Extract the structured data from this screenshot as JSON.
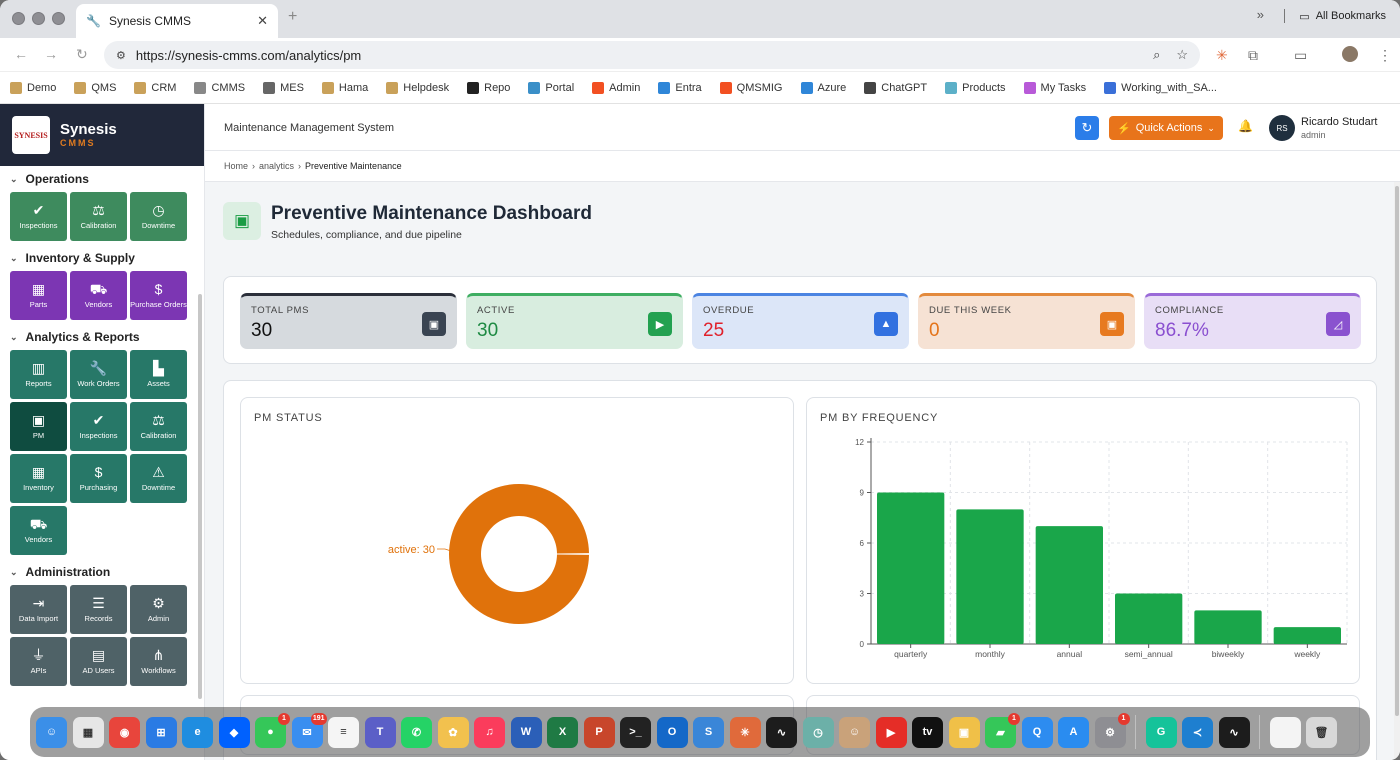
{
  "browser": {
    "tab_title": "Synesis CMMS",
    "url": "https://synesis-cmms.com/analytics/pm",
    "bookmarks": [
      {
        "label": "Demo",
        "color": "#c9a15a"
      },
      {
        "label": "QMS",
        "color": "#c9a15a"
      },
      {
        "label": "CRM",
        "color": "#c9a15a"
      },
      {
        "label": "CMMS",
        "color": "#888888"
      },
      {
        "label": "MES",
        "color": "#666666"
      },
      {
        "label": "Hama",
        "color": "#c9a15a"
      },
      {
        "label": "Helpdesk",
        "color": "#c9a15a"
      },
      {
        "label": "Repo",
        "color": "#222222"
      },
      {
        "label": "Portal",
        "color": "#3a8fc8"
      },
      {
        "label": "Admin",
        "color": "#f25022"
      },
      {
        "label": "Entra",
        "color": "#2f86d8"
      },
      {
        "label": "QMSMIG",
        "color": "#f25022"
      },
      {
        "label": "Azure",
        "color": "#2f86d8"
      },
      {
        "label": "ChatGPT",
        "color": "#444444"
      },
      {
        "label": "Products",
        "color": "#5cb0c8"
      },
      {
        "label": "My Tasks",
        "color": "#b85ad8"
      },
      {
        "label": "Working_with_SA...",
        "color": "#3a6fd8"
      }
    ],
    "all_bookmarks": "All Bookmarks"
  },
  "brand": {
    "name": "Synesis",
    "sub": "CMMS",
    "logo": "SYNESIS"
  },
  "sidebar": {
    "operations": {
      "title": "Operations",
      "items": [
        {
          "label": "Inspections",
          "icon": "✔"
        },
        {
          "label": "Calibration",
          "icon": "⚖"
        },
        {
          "label": "Downtime",
          "icon": "◷"
        }
      ]
    },
    "inventory": {
      "title": "Inventory & Supply",
      "items": [
        {
          "label": "Parts",
          "icon": "▦"
        },
        {
          "label": "Vendors",
          "icon": "⛟"
        },
        {
          "label": "Purchase Orders",
          "icon": "$"
        }
      ]
    },
    "analytics": {
      "title": "Analytics & Reports",
      "items": [
        {
          "label": "Reports",
          "icon": "▥"
        },
        {
          "label": "Work Orders",
          "icon": "🔧"
        },
        {
          "label": "Assets",
          "icon": "▙"
        },
        {
          "label": "PM",
          "icon": "▣"
        },
        {
          "label": "Inspections",
          "icon": "✔"
        },
        {
          "label": "Calibration",
          "icon": "⚖"
        },
        {
          "label": "Inventory",
          "icon": "▦"
        },
        {
          "label": "Purchasing",
          "icon": "$"
        },
        {
          "label": "Downtime",
          "icon": "⚠"
        },
        {
          "label": "Vendors",
          "icon": "⛟"
        }
      ]
    },
    "administration": {
      "title": "Administration",
      "items": [
        {
          "label": "Data Import",
          "icon": "⇥"
        },
        {
          "label": "Records",
          "icon": "☰"
        },
        {
          "label": "Admin",
          "icon": "⚙"
        },
        {
          "label": "APIs",
          "icon": "⏚"
        },
        {
          "label": "AD Users",
          "icon": "▤"
        },
        {
          "label": "Workflows",
          "icon": "⋔"
        }
      ]
    }
  },
  "header": {
    "app_title": "Maintenance Management System",
    "quick_actions": "Quick Actions",
    "user_initials": "RS",
    "user_name": "Ricardo Studart",
    "user_role": "admin"
  },
  "breadcrumb": {
    "home": "Home",
    "section": "analytics",
    "current": "Preventive Maintenance"
  },
  "page": {
    "title": "Preventive Maintenance Dashboard",
    "subtitle": "Schedules, compliance, and due pipeline"
  },
  "kpis": [
    {
      "label": "TOTAL PMS",
      "value": "30",
      "bg": "#d6dade",
      "border": "#2b2f3a",
      "icon_bg": "#3a4452",
      "value_color": "#111111",
      "icon": "▣"
    },
    {
      "label": "ACTIVE",
      "value": "30",
      "bg": "#d8eddf",
      "border": "#3fae62",
      "icon_bg": "#23a150",
      "value_color": "#1e8a43",
      "icon": "▶"
    },
    {
      "label": "OVERDUE",
      "value": "25",
      "bg": "#dce6f8",
      "border": "#4b84e2",
      "icon_bg": "#3271e0",
      "value_color": "#e0212b",
      "icon": "▲"
    },
    {
      "label": "DUE THIS WEEK",
      "value": "0",
      "bg": "#f6e2d4",
      "border": "#e38a3d",
      "icon_bg": "#e77a20",
      "value_color": "#e4741a",
      "icon": "▣"
    },
    {
      "label": "COMPLIANCE",
      "value": "86.7%",
      "bg": "#e8def6",
      "border": "#9a6ad8",
      "icon_bg": "#8a52cf",
      "value_color": "#8a4fd0",
      "icon": "◿"
    }
  ],
  "charts": {
    "status_title": "PM STATUS",
    "frequency_title": "PM BY FREQUENCY"
  },
  "chart_data": [
    {
      "type": "pie",
      "title": "PM STATUS",
      "categories": [
        "active"
      ],
      "values": [
        30
      ],
      "labels": [
        "active: 30"
      ],
      "colors": [
        "#e0720b"
      ]
    },
    {
      "type": "bar",
      "title": "PM BY FREQUENCY",
      "categories": [
        "quarterly",
        "monthly",
        "annual",
        "semi_annual",
        "biweekly",
        "weekly"
      ],
      "values": [
        9,
        8,
        7,
        3,
        2,
        1
      ],
      "yticks": [
        "0",
        "3",
        "6",
        "9",
        "12"
      ],
      "ylim": [
        0,
        12
      ],
      "grid": true,
      "color": "#1aa64a"
    }
  ],
  "dock": [
    {
      "name": "finder",
      "color": "#3b8fe8",
      "glyph": "☺"
    },
    {
      "name": "launchpad",
      "color": "#e6e6e6",
      "glyph": "▦"
    },
    {
      "name": "chrome",
      "color": "#e8453c",
      "glyph": "◉"
    },
    {
      "name": "windows-app",
      "color": "#2a7be4",
      "glyph": "⊞"
    },
    {
      "name": "edge",
      "color": "#1f8de0",
      "glyph": "e"
    },
    {
      "name": "dropbox",
      "color": "#0061fe",
      "glyph": "◆"
    },
    {
      "name": "messages",
      "color": "#35c759",
      "glyph": "●",
      "badge": "1"
    },
    {
      "name": "mail",
      "color": "#3a8ef0",
      "glyph": "✉",
      "badge": "191"
    },
    {
      "name": "notes",
      "color": "#f5f5f5",
      "glyph": "≡"
    },
    {
      "name": "teams",
      "color": "#5b5fc7",
      "glyph": "T"
    },
    {
      "name": "whatsapp",
      "color": "#25d366",
      "glyph": "✆"
    },
    {
      "name": "photos",
      "color": "#f2c14e",
      "glyph": "✿"
    },
    {
      "name": "music",
      "color": "#fb3c5c",
      "glyph": "♫"
    },
    {
      "name": "word",
      "color": "#2b5fb8",
      "glyph": "W"
    },
    {
      "name": "excel",
      "color": "#1f7a44",
      "glyph": "X"
    },
    {
      "name": "powerpoint",
      "color": "#c8462b",
      "glyph": "P"
    },
    {
      "name": "terminal",
      "color": "#222222",
      "glyph": ">_"
    },
    {
      "name": "outlook",
      "color": "#1468c8",
      "glyph": "O"
    },
    {
      "name": "synesis",
      "color": "#3a86d8",
      "glyph": "S"
    },
    {
      "name": "claude",
      "color": "#e06a3b",
      "glyph": "✳"
    },
    {
      "name": "activity-monitor",
      "color": "#1c1c1c",
      "glyph": "∿"
    },
    {
      "name": "time-machine",
      "color": "#6cb0a8",
      "glyph": "◷"
    },
    {
      "name": "contacts",
      "color": "#c9a27a",
      "glyph": "☺"
    },
    {
      "name": "youtube",
      "color": "#e52d27",
      "glyph": "▶"
    },
    {
      "name": "apple-tv",
      "color": "#111111",
      "glyph": "tv"
    },
    {
      "name": "preview",
      "color": "#f0c048",
      "glyph": "▣"
    },
    {
      "name": "facetime",
      "color": "#35c759",
      "glyph": "▰",
      "badge": "1"
    },
    {
      "name": "quick",
      "color": "#2d8cf0",
      "glyph": "Q"
    },
    {
      "name": "app-store",
      "color": "#2a8cf0",
      "glyph": "A"
    },
    {
      "name": "system-settings",
      "color": "#8e8e93",
      "glyph": "⚙",
      "badge": "1"
    },
    {
      "name": "grammarly",
      "color": "#15c39a",
      "glyph": "G"
    },
    {
      "name": "vscode",
      "color": "#1e7fd0",
      "glyph": "≺"
    },
    {
      "name": "stocks",
      "color": "#1c1c1c",
      "glyph": "∿"
    },
    {
      "name": "document",
      "color": "#f4f4f4",
      "glyph": ""
    },
    {
      "name": "trash",
      "color": "#d8d8d8",
      "glyph": "🗑"
    }
  ]
}
